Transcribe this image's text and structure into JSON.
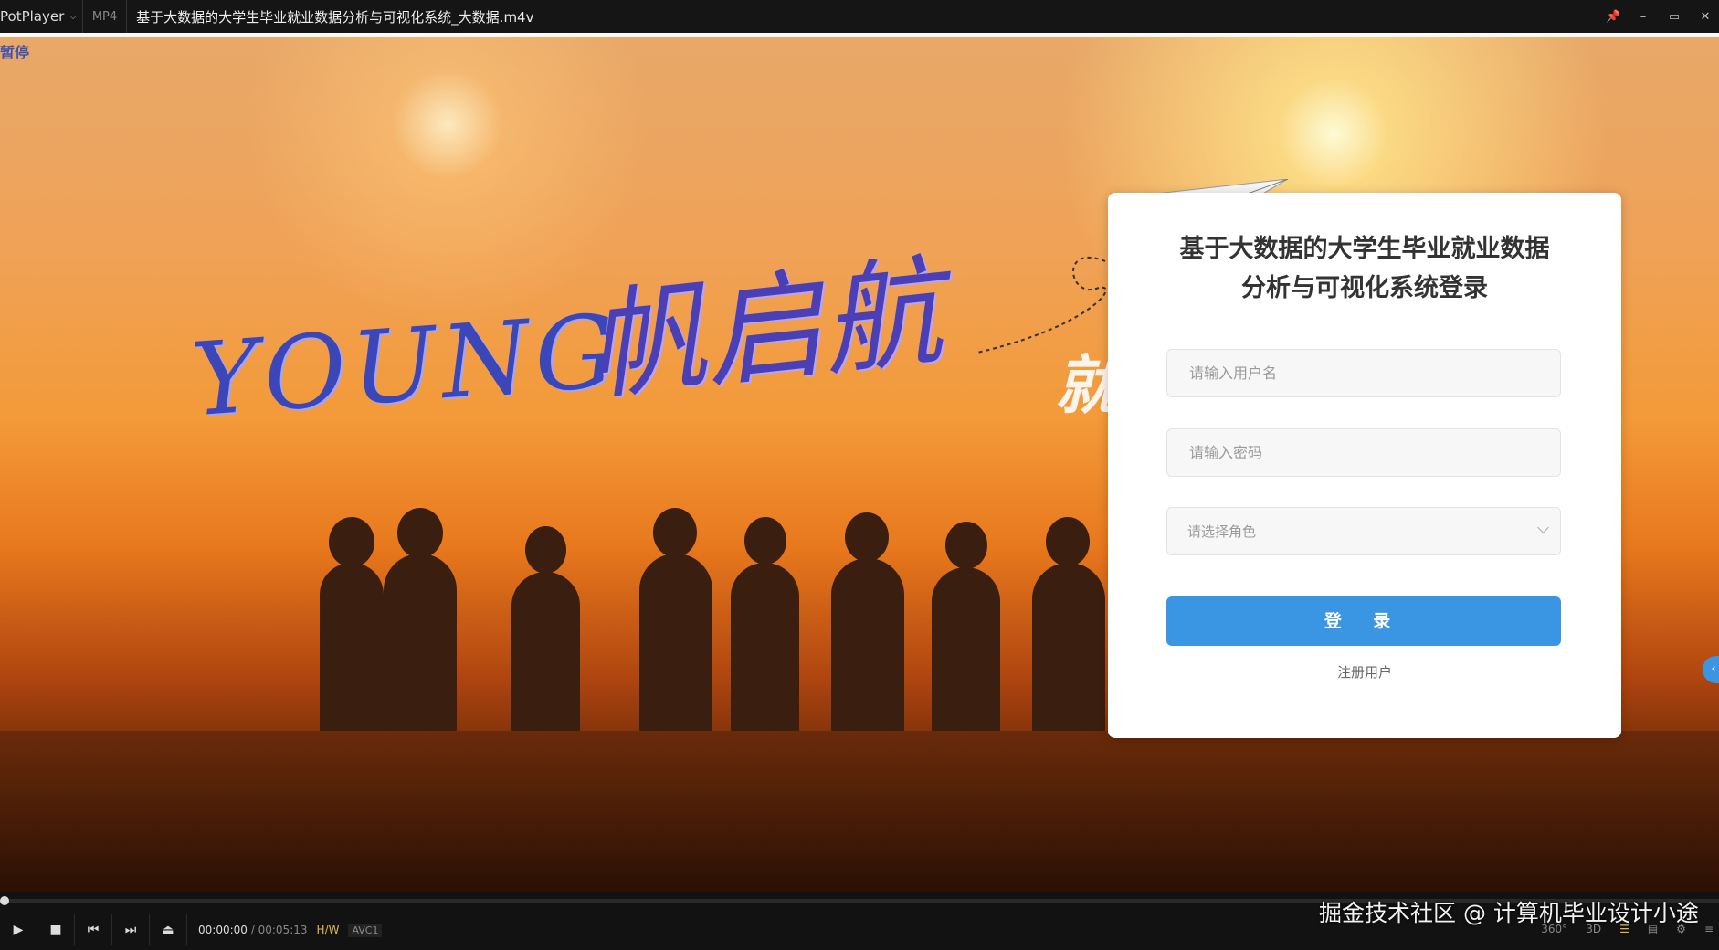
{
  "titlebar": {
    "app_name": "PotPlayer",
    "format": "MP4",
    "file_title": "基于大数据的大学生毕业就业数据分析与可视化系统_大数据.m4v"
  },
  "video": {
    "pause_label": "暂停",
    "young_text": "YOUNG",
    "calligraphy": "帆启航",
    "partial_text": "就"
  },
  "login": {
    "title_line1": "基于大数据的大学生毕业就业数据",
    "title_line2": "分析与可视化系统登录",
    "username_placeholder": "请输入用户名",
    "password_placeholder": "请输入密码",
    "role_placeholder": "请选择角色",
    "login_label": "登 录",
    "register_label": "注册用户",
    "accent_color": "#3a95e2"
  },
  "player": {
    "current_time": "00:00:00",
    "separator": "/",
    "total_time": "00:05:13",
    "hw_label": "H/W",
    "codec": "AVC1",
    "label_360": "360°",
    "label_3d": "3D"
  },
  "watermark": "掘金技术社区 @ 计算机毕业设计小途"
}
